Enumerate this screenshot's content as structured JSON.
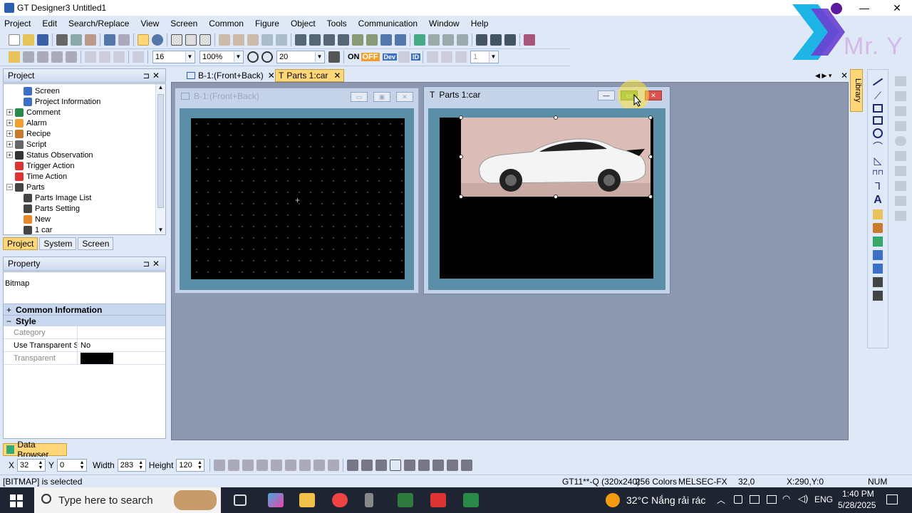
{
  "window": {
    "title": "GT Designer3 Untitled1"
  },
  "logo": {
    "text": "Mr. Y"
  },
  "menu": [
    "Project",
    "Edit",
    "Search/Replace",
    "View",
    "Screen",
    "Common",
    "Figure",
    "Object",
    "Tools",
    "Communication",
    "Window",
    "Help"
  ],
  "toolbar2": {
    "font_size": "16",
    "zoom": "100%",
    "grid": "20",
    "on_label": "ON",
    "off_label": "OFF",
    "dev_label": "Dev",
    "id_label": "ID",
    "layer_value": "1"
  },
  "project_panel": {
    "title": "Project",
    "pin": "ᵖ",
    "tree": [
      {
        "label": "Screen",
        "indent": 2
      },
      {
        "label": "Project Information",
        "indent": 2
      },
      {
        "label": "Comment",
        "indent": 0,
        "expander": "+"
      },
      {
        "label": "Alarm",
        "indent": 0,
        "expander": "+"
      },
      {
        "label": "Recipe",
        "indent": 0,
        "expander": "+"
      },
      {
        "label": "Script",
        "indent": 0,
        "expander": "+"
      },
      {
        "label": "Status Observation",
        "indent": 0,
        "expander": "+"
      },
      {
        "label": "Trigger Action",
        "indent": 0,
        "expander": ""
      },
      {
        "label": "Time Action",
        "indent": 0,
        "expander": ""
      },
      {
        "label": "Parts",
        "indent": 0,
        "expander": "−"
      },
      {
        "label": "Parts Image List",
        "indent": 2
      },
      {
        "label": "Parts Setting",
        "indent": 2
      },
      {
        "label": "New",
        "indent": 2
      },
      {
        "label": "1 car",
        "indent": 2
      }
    ],
    "tabs": [
      "Project",
      "System",
      "Screen"
    ]
  },
  "property_panel": {
    "title": "Property",
    "type": "Bitmap",
    "groups": {
      "common": "Common Information",
      "style": "Style"
    },
    "rows": [
      {
        "key": "Category",
        "value": ""
      },
      {
        "key": "Use Transparent Setti",
        "value": "No"
      },
      {
        "key": "Transparent",
        "value": ""
      }
    ]
  },
  "doc_tabs": [
    "B-1:(Front+Back)",
    "Parts 1:car"
  ],
  "windows": {
    "b1_title": "B-1:(Front+Back)",
    "parts_title": "Parts 1:car"
  },
  "right_tab": "Library",
  "bottom": {
    "data_browser": "Data Browser",
    "x_label": "X",
    "x_value": "32",
    "y_label": "Y",
    "y_value": "0",
    "w_label": "Width",
    "w_value": "283",
    "h_label": "Height",
    "h_value": "120"
  },
  "status": {
    "selected": "[BITMAP] is selected",
    "model": "GT11**-Q (320x240)",
    "colors": "256 Colors",
    "plc": "MELSEC-FX",
    "pos": "32,0",
    "cursor": "X:290,Y:0",
    "num": "NUM"
  },
  "taskbar": {
    "search_placeholder": "Type here to search",
    "weather": "32°C  Nắng rải rác",
    "lang": "ENG",
    "time": "1:40 PM",
    "date": "5/28/2025"
  }
}
